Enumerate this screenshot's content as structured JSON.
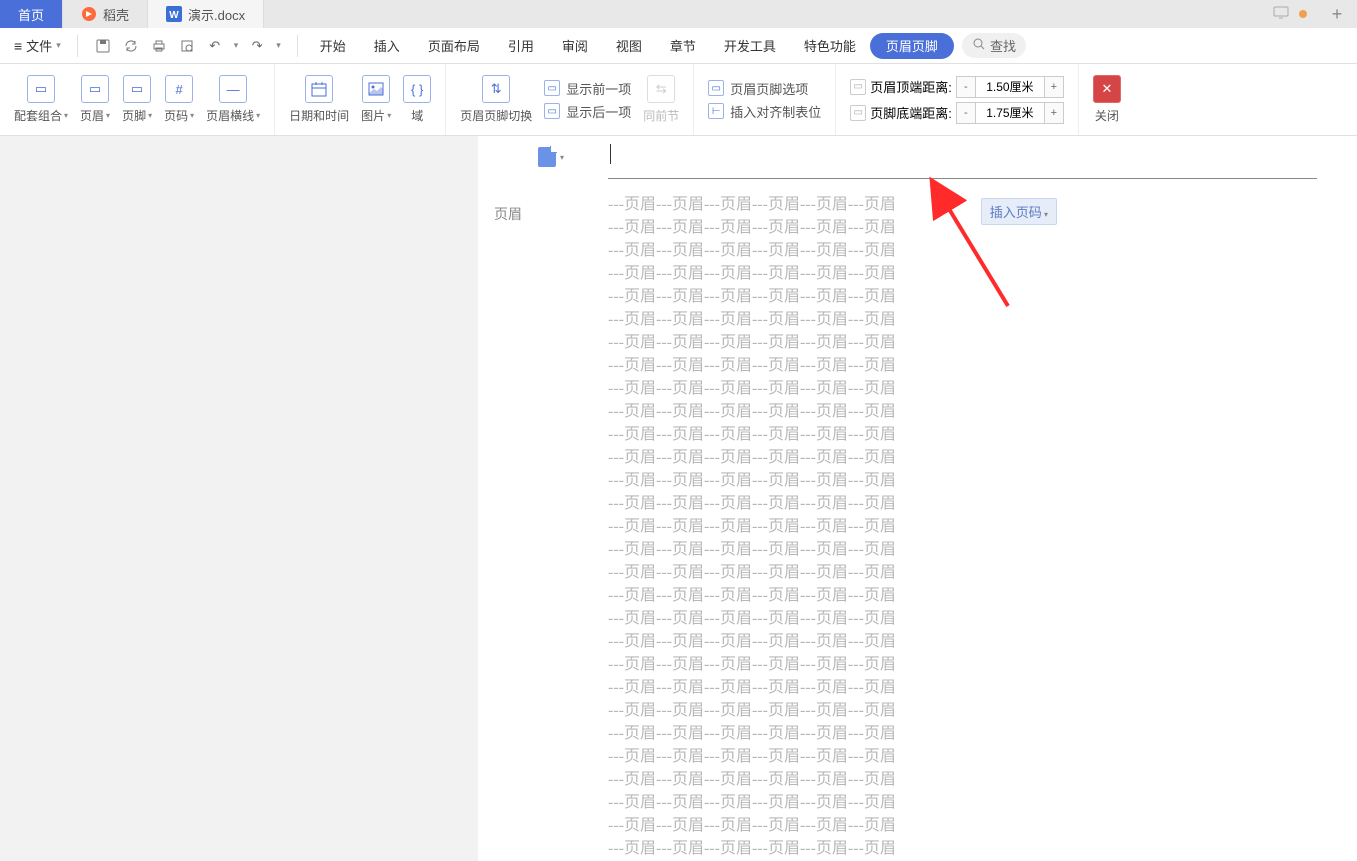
{
  "tabs": {
    "home": "首页",
    "daoke": "稻壳",
    "doc": "演示.docx"
  },
  "file_menu": "文件",
  "menu": {
    "start": "开始",
    "insert": "插入",
    "page_layout": "页面布局",
    "reference": "引用",
    "review": "审阅",
    "view": "视图",
    "chapter": "章节",
    "dev_tools": "开发工具",
    "special": "特色功能",
    "header_footer": "页眉页脚",
    "search": "查找"
  },
  "ribbon": {
    "combo": "配套组合",
    "header": "页眉",
    "footer": "页脚",
    "page_num": "页码",
    "header_line": "页眉横线",
    "datetime": "日期和时间",
    "picture": "图片",
    "field": "域",
    "hf_switch": "页眉页脚切换",
    "show_prev": "显示前一项",
    "show_next": "显示后一项",
    "same_prev": "同前节",
    "hf_options": "页眉页脚选项",
    "insert_align": "插入对齐制表位",
    "header_top_dist": "页眉顶端距离:",
    "footer_bottom_dist": "页脚底端距离:",
    "header_top_val": "1.50厘米",
    "footer_bottom_val": "1.75厘米",
    "close": "关闭"
  },
  "doc": {
    "header_label": "页眉",
    "insert_page_num": "插入页码",
    "body_line": "---页眉---页眉---页眉---页眉---页眉---页眉"
  }
}
